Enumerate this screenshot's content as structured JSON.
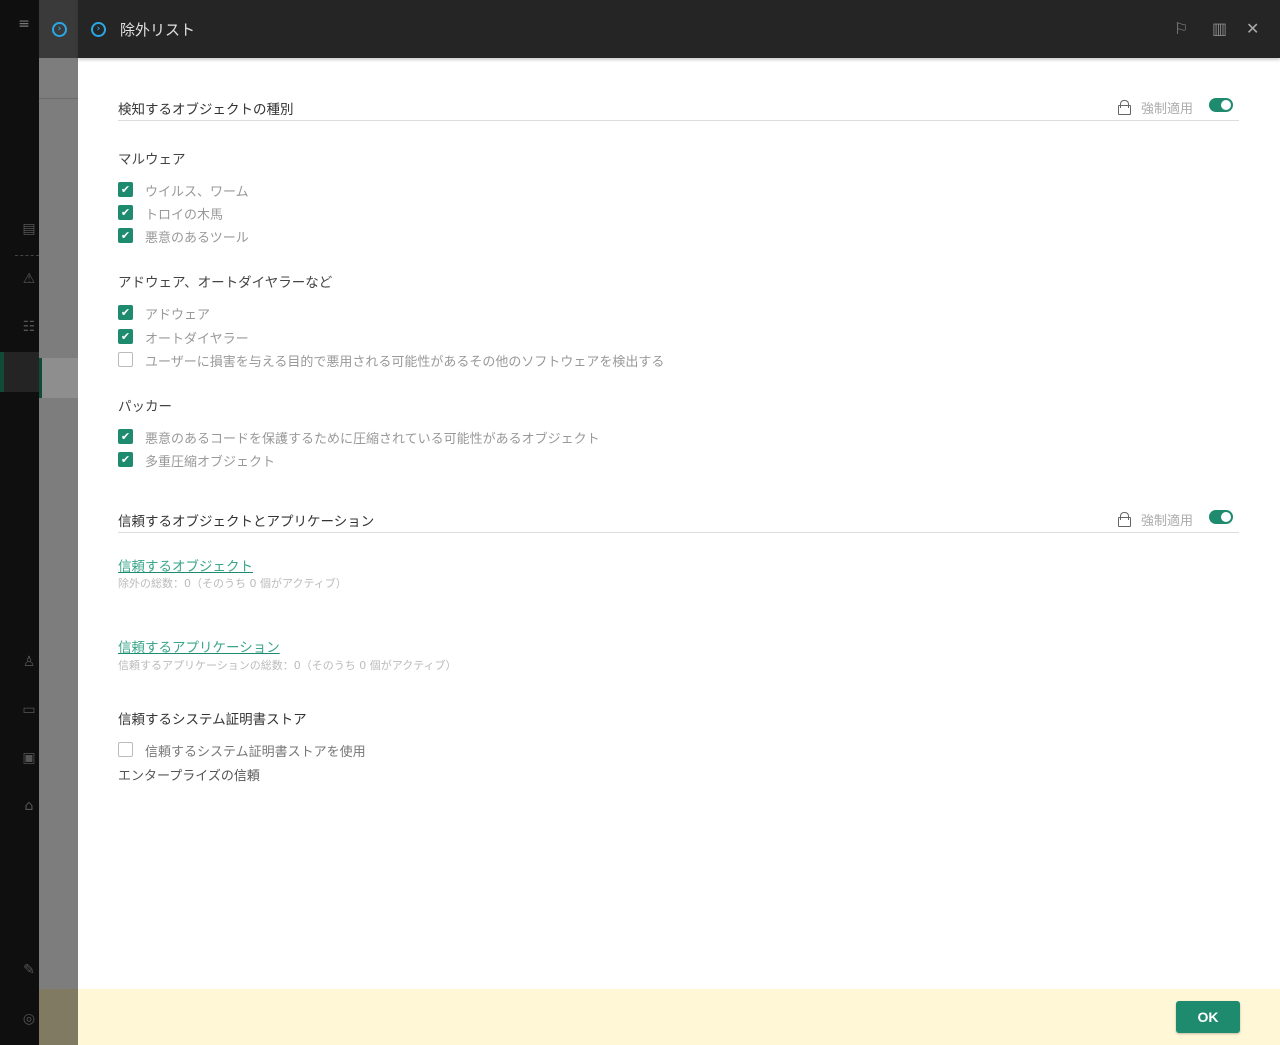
{
  "header": {
    "title": "除外リスト"
  },
  "section_object_types": {
    "title": "検知するオブジェクトの種別",
    "enforce_label": "強制適用",
    "enforced": true,
    "groups": [
      {
        "title": "マルウェア",
        "items": [
          {
            "label": "ウイルス、ワーム",
            "checked": true
          },
          {
            "label": "トロイの木馬",
            "checked": true
          },
          {
            "label": "悪意のあるツール",
            "checked": true
          }
        ]
      },
      {
        "title": "アドウェア、オートダイヤラーなど",
        "items": [
          {
            "label": "アドウェア",
            "checked": true
          },
          {
            "label": "オートダイヤラー",
            "checked": true
          },
          {
            "label": "ユーザーに損害を与える目的で悪用される可能性があるその他のソフトウェアを検出する",
            "checked": false
          }
        ]
      },
      {
        "title": "パッカー",
        "items": [
          {
            "label": "悪意のあるコードを保護するために圧縮されている可能性があるオブジェクト",
            "checked": true
          },
          {
            "label": "多重圧縮オブジェクト",
            "checked": true
          }
        ]
      }
    ]
  },
  "section_trusted": {
    "title": "信頼するオブジェクトとアプリケーション",
    "enforce_label": "強制適用",
    "enforced": true,
    "trusted_objects_link": "信頼するオブジェクト",
    "trusted_objects_summary": "除外の総数：0（そのうち 0 個がアクティブ）",
    "trusted_apps_link": "信頼するアプリケーション",
    "trusted_apps_summary": "信頼するアプリケーションの総数：0（そのうち 0 個がアクティブ）"
  },
  "section_cert": {
    "title": "信頼するシステム証明書ストア",
    "use_store_label": "信頼するシステム証明書ストアを使用",
    "use_store_checked": false,
    "enterprise_label": "エンタープライズの信頼"
  },
  "footer": {
    "ok_label": "OK"
  }
}
